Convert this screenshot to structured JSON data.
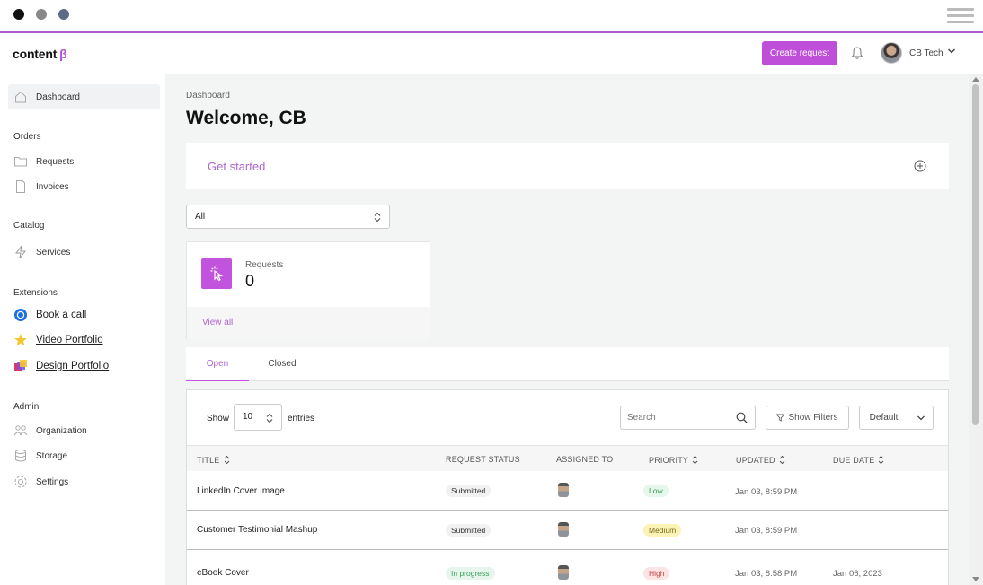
{
  "header": {
    "logo_text": "content",
    "logo_beta": "β",
    "create_label": "Create request",
    "user_name": "CB Tech"
  },
  "sidebar": {
    "dashboard": "Dashboard",
    "orders_section": "Orders",
    "requests": "Requests",
    "invoices": "Invoices",
    "catalog_section": "Catalog",
    "services": "Services",
    "extensions_section": "Extensions",
    "book_call": "Book a call",
    "video_portfolio": "Video Portfolio",
    "design_portfolio": "Design Portfolio",
    "admin_section": "Admin",
    "organization": "Organization",
    "storage": "Storage",
    "settings": "Settings"
  },
  "main": {
    "breadcrumb": "Dashboard",
    "title": "Welcome, CB",
    "get_started": "Get started",
    "filter_value": "All",
    "card": {
      "label": "Requests",
      "count": "0",
      "link": "View all"
    },
    "tabs": [
      "Open",
      "Closed"
    ]
  },
  "table": {
    "show_label": "Show",
    "entries_value": "10",
    "entries_label": "entries",
    "search_placeholder": "Search",
    "filters_label": "Show Filters",
    "default_label": "Default",
    "columns": [
      "TITLE",
      "REQUEST STATUS",
      "ASSIGNED TO",
      "PRIORITY",
      "UPDATED",
      "DUE DATE"
    ],
    "rows": [
      {
        "title": "LinkedIn Cover Image",
        "status": "Submitted",
        "priority": "Low",
        "updated": "Jan 03, 8:59 PM",
        "due": ""
      },
      {
        "title": "Customer Testimonial Mashup",
        "status": "Submitted",
        "priority": "Medium",
        "updated": "Jan 03, 8:59 PM",
        "due": ""
      },
      {
        "title": "eBook Cover",
        "status": "In progress",
        "priority": "High",
        "updated": "Jan 03, 8:58 PM",
        "due": "Jan 06, 2023"
      }
    ]
  },
  "colors": {
    "accent": "#bf4fd9",
    "accent_text": "#b065cc"
  },
  "icons": [
    "home-icon",
    "folder-icon",
    "document-icon",
    "lightning-icon",
    "calendar-icon",
    "star-icon",
    "design-icon",
    "people-icon",
    "database-icon",
    "gear-icon",
    "bell-icon",
    "search-icon",
    "filter-icon",
    "plus-circle-icon",
    "cursor-click-icon"
  ]
}
